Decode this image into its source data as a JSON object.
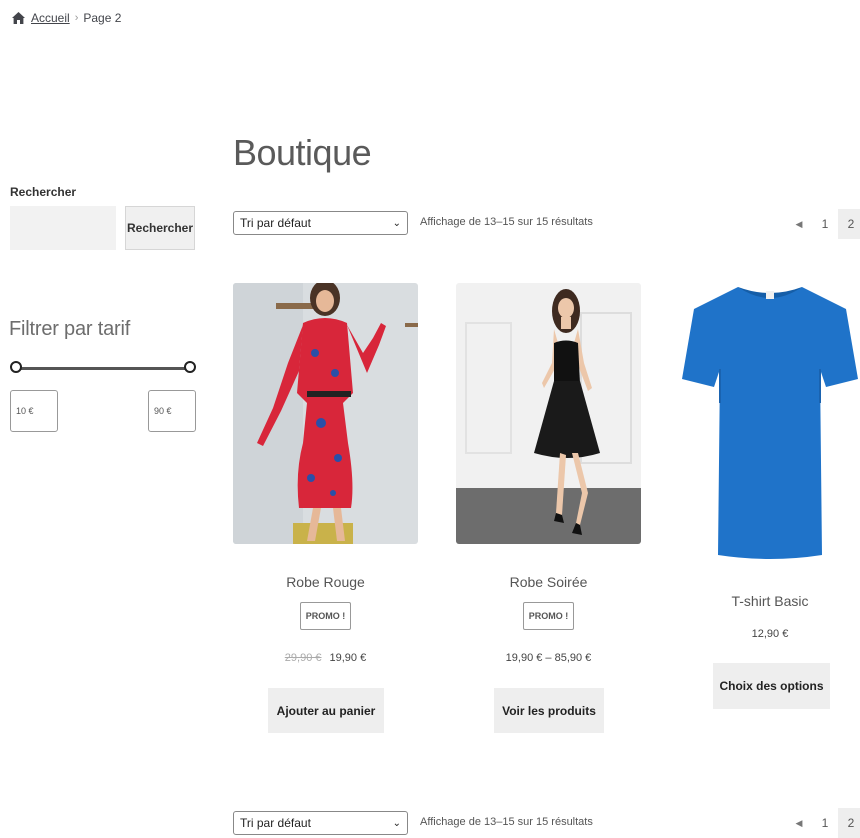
{
  "breadcrumb": {
    "home": "Accueil",
    "separator": "›",
    "current": "Page 2"
  },
  "sidebar": {
    "search_title": "Rechercher",
    "search_placeholder": "",
    "search_button": "Rechercher",
    "filter_title": "Filtrer par tarif",
    "price_min": "10 €",
    "price_max": "90 €"
  },
  "main": {
    "title": "Boutique",
    "sort_selected": "Tri par défaut",
    "results_text": "Affichage de 13–15 sur 15 résultats",
    "pagination": {
      "prev": "◀",
      "pages": [
        "1",
        "2"
      ],
      "current": "2"
    }
  },
  "products": [
    {
      "name": "Robe Rouge",
      "badge": "PROMO !",
      "old_price": "29,90 €",
      "price": "19,90 €",
      "button": "Ajouter au panier"
    },
    {
      "name": "Robe Soirée",
      "badge": "PROMO !",
      "price": "19,90 € – 85,90 €",
      "button": "Voir les produits"
    },
    {
      "name": "T-shirt Basic",
      "price": "12,90 €",
      "button": "Choix des options"
    }
  ],
  "colors": {
    "text": "#43454b",
    "button_bg": "#eeeeee",
    "tshirt": "#1f73c9",
    "dress_red": "#d8263a"
  }
}
